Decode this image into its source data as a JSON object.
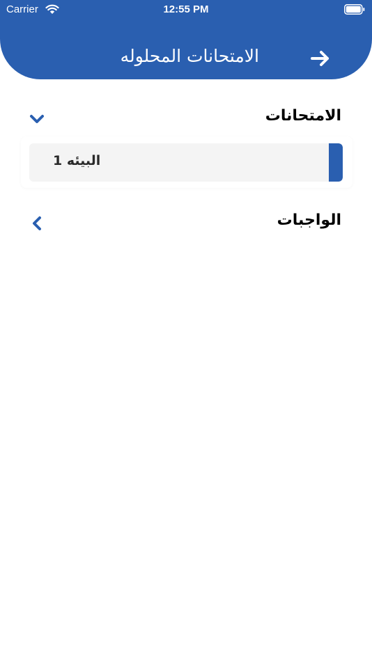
{
  "status_bar": {
    "carrier": "Carrier",
    "time": "12:55 PM"
  },
  "header": {
    "title": "الامتحانات المحلوله",
    "back_icon": "arrow-right-icon",
    "color": "#2a5fb0"
  },
  "sections": [
    {
      "title": "الامتحانات",
      "expanded": true,
      "chevron_icon": "chevron-down-icon",
      "items": [
        {
          "label": "البيئه 1"
        }
      ]
    },
    {
      "title": "الواجبات",
      "expanded": false,
      "chevron_icon": "chevron-left-icon",
      "items": []
    }
  ]
}
